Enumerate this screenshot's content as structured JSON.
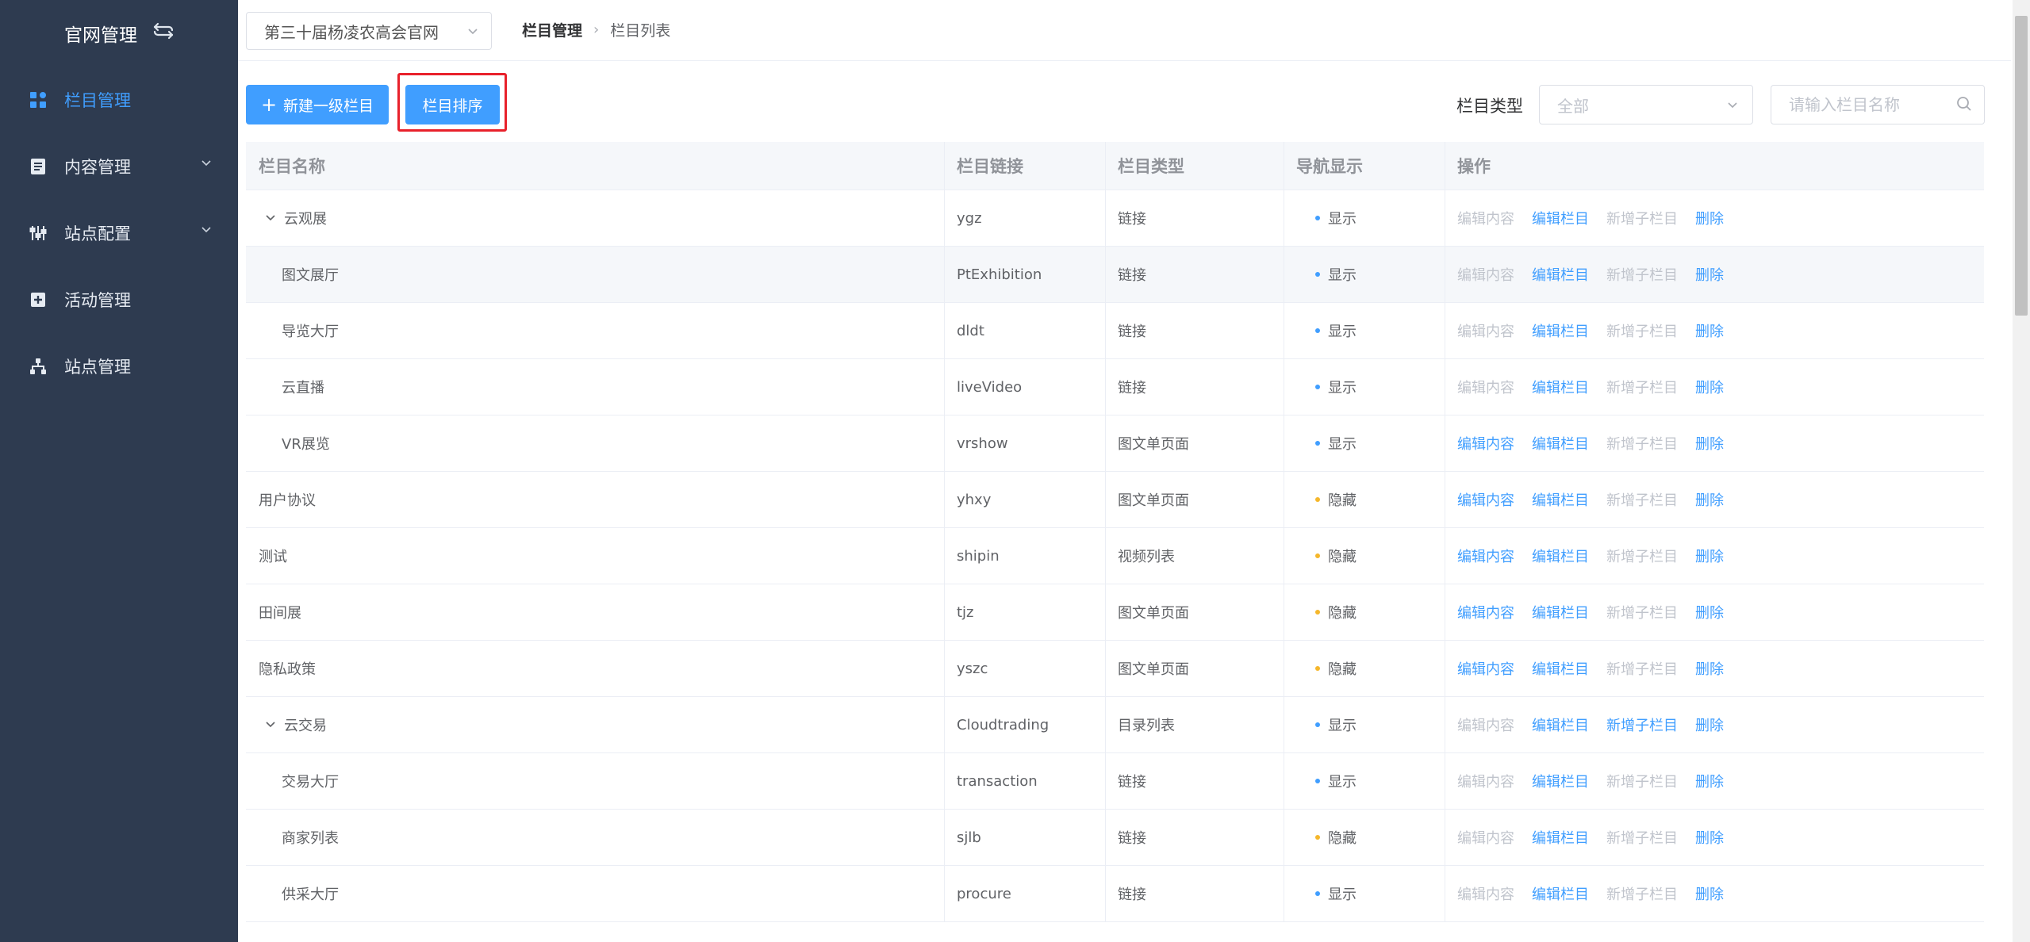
{
  "app": {
    "title": "官网管理"
  },
  "sidebar": {
    "items": [
      {
        "label": "栏目管理",
        "icon": "grid-icon",
        "active": true
      },
      {
        "label": "内容管理",
        "icon": "document-icon",
        "has_children": true
      },
      {
        "label": "站点配置",
        "icon": "settings-sliders-icon",
        "has_children": true
      },
      {
        "label": "活动管理",
        "icon": "plus-square-icon"
      },
      {
        "label": "站点管理",
        "icon": "sitemap-icon"
      }
    ]
  },
  "header": {
    "site_select": "第三十届杨凌农高会官网",
    "breadcrumb": [
      "栏目管理",
      "栏目列表"
    ]
  },
  "toolbar": {
    "new_label": "新建一级栏目",
    "sort_label": "栏目排序",
    "type_label": "栏目类型",
    "type_value": "全部",
    "search_placeholder": "请输入栏目名称"
  },
  "table": {
    "headers": [
      "栏目名称",
      "栏目链接",
      "栏目类型",
      "导航显示",
      "操作"
    ],
    "ops": [
      "编辑内容",
      "编辑栏目",
      "新增子栏目",
      "删除"
    ],
    "rows": [
      {
        "name": "云观展",
        "link": "ygz",
        "type": "链接",
        "nav": "显示",
        "level": "parent",
        "ops_enabled": [
          false,
          true,
          false,
          true
        ]
      },
      {
        "name": "图文展厅",
        "link": "PtExhibition",
        "type": "链接",
        "nav": "显示",
        "level": "child",
        "ops_enabled": [
          false,
          true,
          false,
          true
        ]
      },
      {
        "name": "导览大厅",
        "link": "dldt",
        "type": "链接",
        "nav": "显示",
        "level": "child",
        "ops_enabled": [
          false,
          true,
          false,
          true
        ]
      },
      {
        "name": "云直播",
        "link": "liveVideo",
        "type": "链接",
        "nav": "显示",
        "level": "child",
        "ops_enabled": [
          false,
          true,
          false,
          true
        ]
      },
      {
        "name": "VR展览",
        "link": "vrshow",
        "type": "图文单页面",
        "nav": "显示",
        "level": "child",
        "ops_enabled": [
          true,
          true,
          false,
          true
        ]
      },
      {
        "name": "用户协议",
        "link": "yhxy",
        "type": "图文单页面",
        "nav": "隐藏",
        "level": "top",
        "ops_enabled": [
          true,
          true,
          false,
          true
        ]
      },
      {
        "name": "测试",
        "link": "shipin",
        "type": "视频列表",
        "nav": "隐藏",
        "level": "top",
        "ops_enabled": [
          true,
          true,
          false,
          true
        ]
      },
      {
        "name": "田间展",
        "link": "tjz",
        "type": "图文单页面",
        "nav": "隐藏",
        "level": "top",
        "ops_enabled": [
          true,
          true,
          false,
          true
        ]
      },
      {
        "name": "隐私政策",
        "link": "yszc",
        "type": "图文单页面",
        "nav": "隐藏",
        "level": "top",
        "ops_enabled": [
          true,
          true,
          false,
          true
        ]
      },
      {
        "name": "云交易",
        "link": "Cloudtrading",
        "type": "目录列表",
        "nav": "显示",
        "level": "parent",
        "ops_enabled": [
          false,
          true,
          true,
          true
        ]
      },
      {
        "name": "交易大厅",
        "link": "transaction",
        "type": "链接",
        "nav": "显示",
        "level": "child",
        "ops_enabled": [
          false,
          true,
          false,
          true
        ]
      },
      {
        "name": "商家列表",
        "link": "sjlb",
        "type": "链接",
        "nav": "隐藏",
        "level": "child",
        "ops_enabled": [
          false,
          true,
          false,
          true
        ]
      },
      {
        "name": "供采大厅",
        "link": "procure",
        "type": "链接",
        "nav": "显示",
        "level": "child",
        "ops_enabled": [
          false,
          true,
          false,
          true
        ]
      }
    ]
  },
  "colors": {
    "sidebar_bg": "#2e3b50",
    "accent": "#409eff",
    "show_dot": "#409eff",
    "hide_dot": "#f5b72b",
    "disabled_op": "#c0c4cc",
    "highlight_box": "#e8212b"
  }
}
